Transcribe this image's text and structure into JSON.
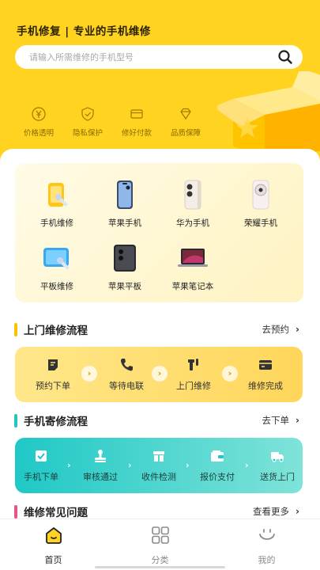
{
  "header": {
    "slogan": "手机修复 | 专业的手机维修",
    "search_placeholder": "请输入所需维修的手机型号"
  },
  "features": [
    {
      "label": "价格透明",
      "icon": "yen-icon"
    },
    {
      "label": "隐私保护",
      "icon": "shield-check-icon"
    },
    {
      "label": "修好付款",
      "icon": "card-icon"
    },
    {
      "label": "品质保障",
      "icon": "diamond-icon"
    }
  ],
  "categories": [
    {
      "label": "手机维修",
      "icon": "phone-repair-icon"
    },
    {
      "label": "苹果手机",
      "icon": "iphone-icon"
    },
    {
      "label": "华为手机",
      "icon": "huawei-phone-icon"
    },
    {
      "label": "荣耀手机",
      "icon": "honor-phone-icon"
    },
    {
      "label": "平板维修",
      "icon": "tablet-repair-icon"
    },
    {
      "label": "苹果平板",
      "icon": "ipad-icon"
    },
    {
      "label": "苹果笔记本",
      "icon": "macbook-icon"
    }
  ],
  "onsite": {
    "title": "上门维修流程",
    "more": "去预约",
    "accent": "#f7c500",
    "steps": [
      {
        "label": "预约下单",
        "icon": "order-icon"
      },
      {
        "label": "等待电联",
        "icon": "phone-call-icon"
      },
      {
        "label": "上门维修",
        "icon": "tool-icon"
      },
      {
        "label": "维修完成",
        "icon": "complete-card-icon"
      }
    ]
  },
  "mail": {
    "title": "手机寄修流程",
    "more": "去下单",
    "accent": "#22c7c0",
    "steps": [
      {
        "label": "手机下单",
        "icon": "check-doc-icon"
      },
      {
        "label": "审核通过",
        "icon": "stamp-icon"
      },
      {
        "label": "收件检测",
        "icon": "box-icon"
      },
      {
        "label": "报价支付",
        "icon": "wallet-icon"
      },
      {
        "label": "送货上门",
        "icon": "truck-icon"
      }
    ]
  },
  "faq": {
    "title": "维修常见问题",
    "more": "查看更多",
    "accent": "#f0508a"
  },
  "tabbar": [
    {
      "label": "首页",
      "icon": "home-icon",
      "active": true
    },
    {
      "label": "分类",
      "icon": "grid-icon",
      "active": false
    },
    {
      "label": "我的",
      "icon": "smile-icon",
      "active": false
    }
  ]
}
